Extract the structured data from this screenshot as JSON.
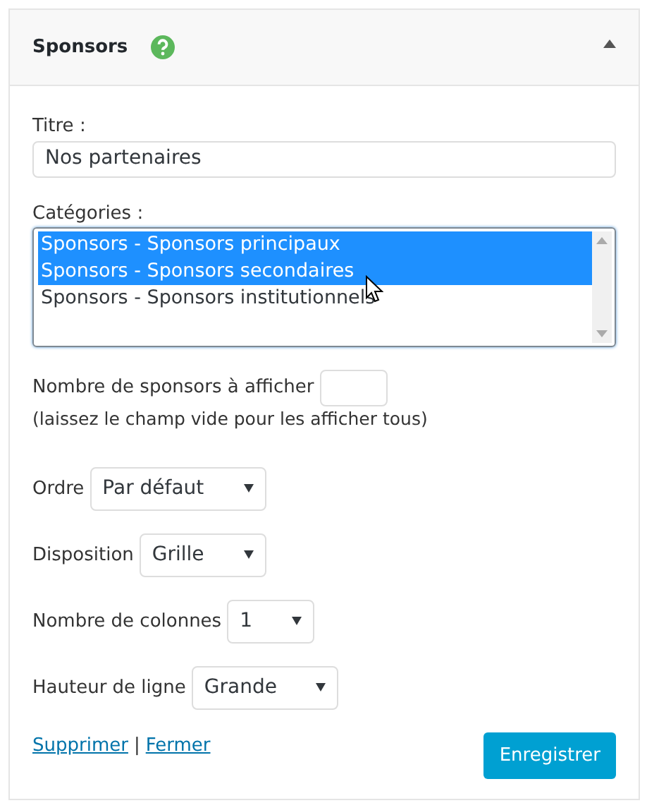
{
  "widget": {
    "title": "Sponsors",
    "expanded": true
  },
  "title_field": {
    "label": "Titre :",
    "value": "Nos partenaires"
  },
  "categories": {
    "label": "Catégories :",
    "options": [
      {
        "text": "Sponsors - Sponsors principaux",
        "selected": true
      },
      {
        "text": "Sponsors - Sponsors secondaires",
        "selected": true
      },
      {
        "text": "Sponsors - Sponsors institutionnels",
        "selected": false
      }
    ]
  },
  "count": {
    "label": "Nombre de sponsors à afficher",
    "hint": "(laissez le champ vide pour les afficher tous)"
  },
  "selects": [
    {
      "label": "Ordre",
      "value": "Par défaut"
    },
    {
      "label": "Disposition",
      "value": "Grille"
    },
    {
      "label": "Nombre de colonnes",
      "value": "1"
    },
    {
      "label": "Hauteur de ligne",
      "value": "Grande"
    }
  ],
  "links": [
    "Supprimer",
    "Fermer"
  ],
  "separator": "|",
  "save_button": "Enregistrer"
}
